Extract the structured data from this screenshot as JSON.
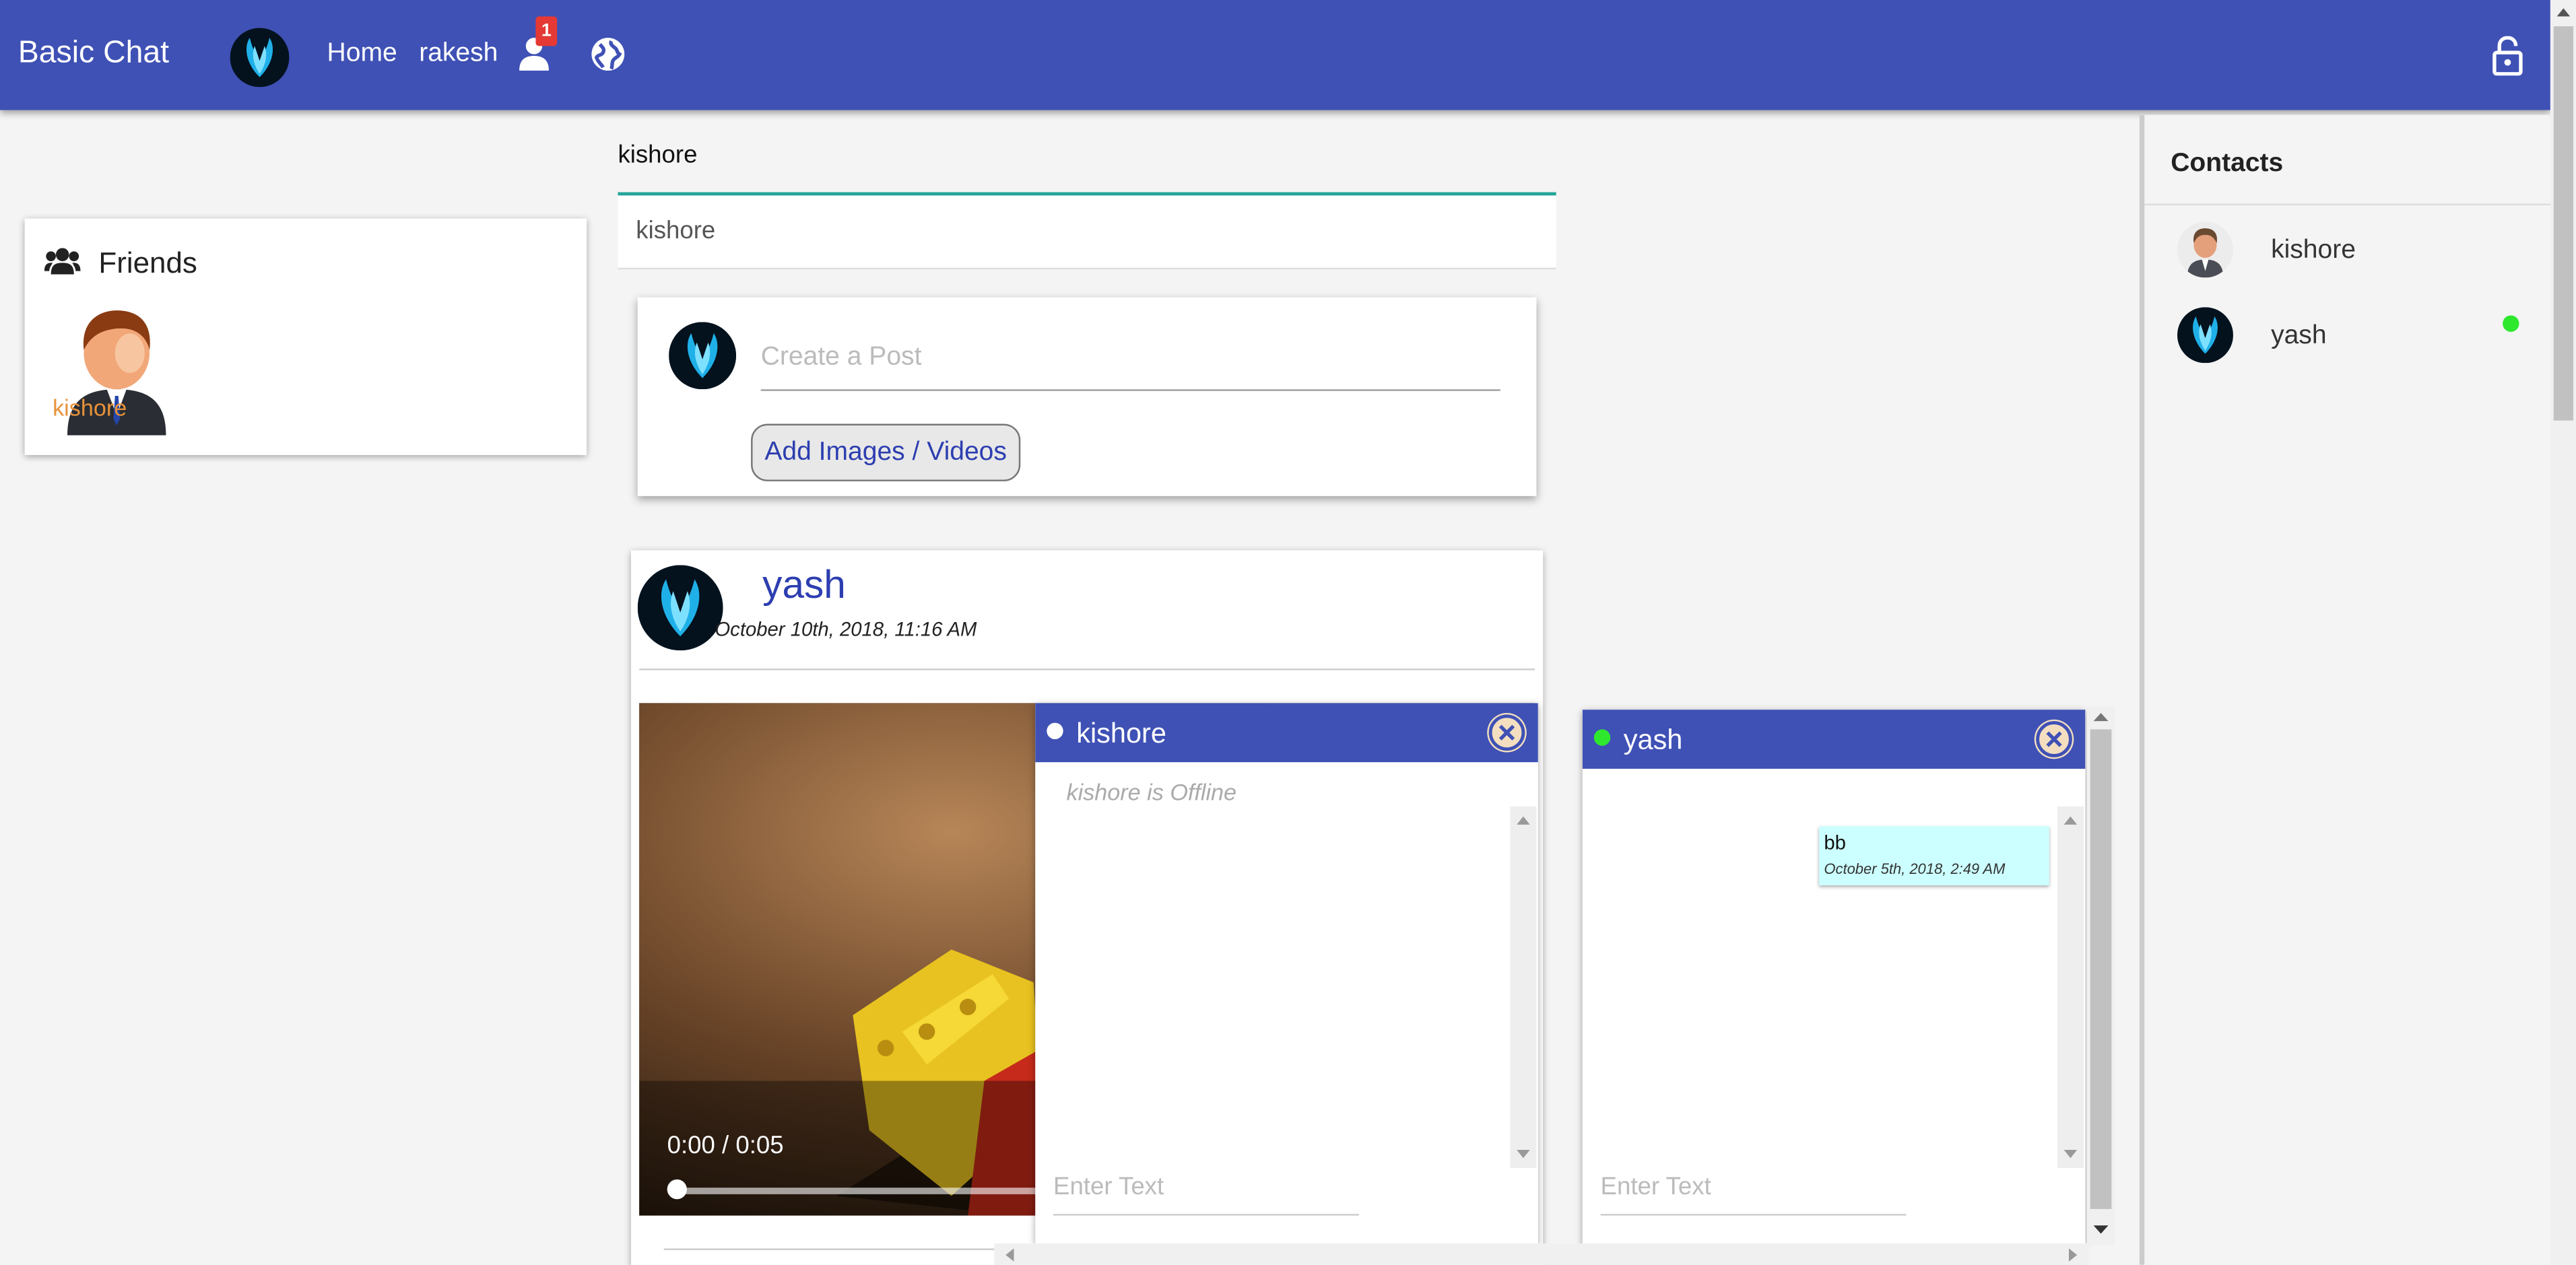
{
  "navbar": {
    "brand": "Basic Chat",
    "home_label": "Home",
    "user_label": "rakesh",
    "notification_count": "1",
    "icons": [
      "user-avatar",
      "friend-requests-icon",
      "globe-icon",
      "lock-icon"
    ]
  },
  "friends": {
    "title": "Friends",
    "items": [
      {
        "name": "kishore"
      }
    ]
  },
  "search": {
    "label": "kishore",
    "value": "kishore"
  },
  "create_post": {
    "placeholder": "Create a Post",
    "add_media_label": "Add Images / Videos"
  },
  "post": {
    "author": "yash",
    "timestamp": "October 10th, 2018, 11:16 AM",
    "video_time": "0:00 / 0:05",
    "video_progress": 0
  },
  "chats": [
    {
      "name": "kishore",
      "online": false,
      "status_text": "kishore is Offline",
      "input_placeholder": "Enter Text",
      "messages": []
    },
    {
      "name": "yash",
      "online": true,
      "status_text": "",
      "input_placeholder": "Enter Text",
      "messages": [
        {
          "text": "bb",
          "time": "October 5th, 2018, 2:49 AM"
        }
      ]
    }
  ],
  "contacts": {
    "title": "Contacts",
    "items": [
      {
        "name": "kishore",
        "online": false
      },
      {
        "name": "yash",
        "online": true
      }
    ]
  },
  "colors": {
    "primary": "#3f51b5",
    "accent_teal": "#26a69a",
    "online": "#2ee82e",
    "badge": "#e53935",
    "message_bubble": "#ccffff"
  }
}
